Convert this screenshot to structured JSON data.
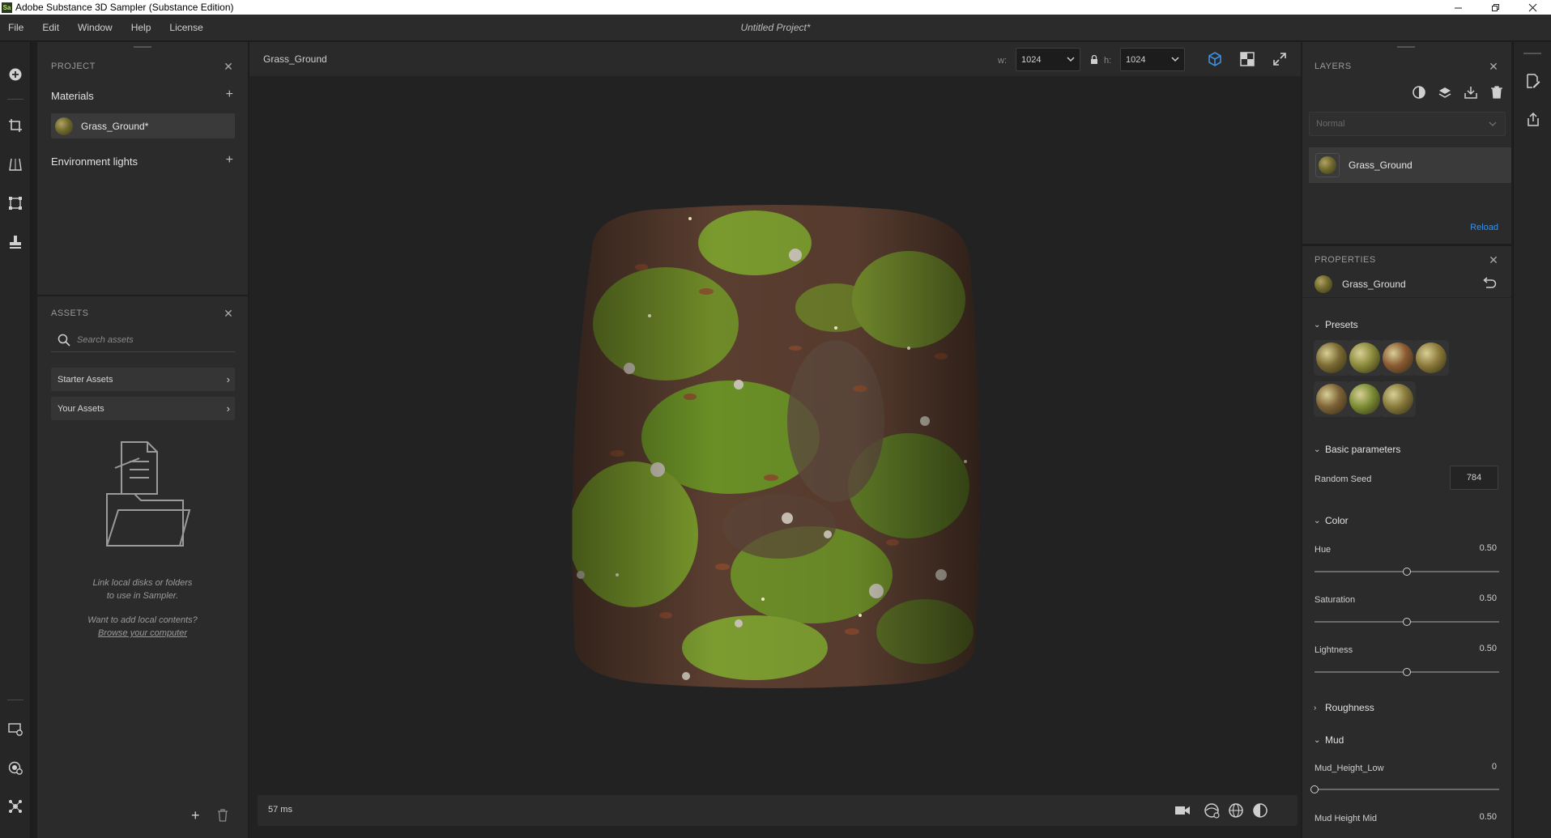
{
  "window": {
    "app_icon": "Sa",
    "title": "Adobe Substance 3D Sampler (Substance Edition)",
    "controls": [
      "minimize-icon",
      "restore-icon",
      "close-icon"
    ]
  },
  "menu": {
    "items": [
      "File",
      "Edit",
      "Window",
      "Help",
      "License"
    ],
    "project_title": "Untitled Project*"
  },
  "left_toolbar": {
    "icons": [
      "add-circle-icon",
      "crop-icon",
      "perspective-icon",
      "transform-icon",
      "stamp-icon",
      "display-icon",
      "material-library-icon",
      "plugins-icon"
    ]
  },
  "project": {
    "header": "PROJECT",
    "materials_label": "Materials",
    "material_items": [
      {
        "name": "Grass_Ground*"
      }
    ],
    "environment_label": "Environment lights"
  },
  "assets": {
    "header": "ASSETS",
    "search_placeholder": "Search assets",
    "rows": [
      "Starter Assets",
      "Your Assets"
    ],
    "empty_line1": "Link local disks or folders",
    "empty_line2": "to use in Sampler.",
    "empty_line3": "Want to add local contents?",
    "browse_link": "Browse your computer"
  },
  "viewport": {
    "title": "Grass_Ground",
    "width_label": "w:",
    "width_value": "1024",
    "height_label": "h:",
    "height_value": "1024",
    "render_time": "57 ms"
  },
  "layers": {
    "header": "LAYERS",
    "blend_mode": "Normal",
    "items": [
      {
        "name": "Grass_Ground"
      }
    ],
    "reload_label": "Reload"
  },
  "properties": {
    "header": "PROPERTIES",
    "material_name": "Grass_Ground",
    "presets_label": "Presets",
    "presets": [
      {
        "color": "#7a6a32"
      },
      {
        "color": "#8a8a3a"
      },
      {
        "color": "#8a5a32"
      },
      {
        "color": "#8c7a3a"
      },
      {
        "color": "#7e6236"
      },
      {
        "color": "#7a8c34"
      },
      {
        "color": "#86793a"
      }
    ],
    "basic_label": "Basic parameters",
    "random_seed_label": "Random Seed",
    "random_seed_value": "784",
    "color_label": "Color",
    "hue_label": "Hue",
    "hue_value": "0.50",
    "saturation_label": "Saturation",
    "saturation_value": "0.50",
    "lightness_label": "Lightness",
    "lightness_value": "0.50",
    "roughness_label": "Roughness",
    "mud_label": "Mud",
    "mud_low_label": "Mud_Height_Low",
    "mud_low_value": "0",
    "mud_mid_label": "Mud Height Mid",
    "mud_mid_value": "0.50"
  },
  "colors": {
    "accent": "#3d8fe0",
    "panel_bg": "#2b2b2b",
    "viewport_bg": "#222222"
  }
}
